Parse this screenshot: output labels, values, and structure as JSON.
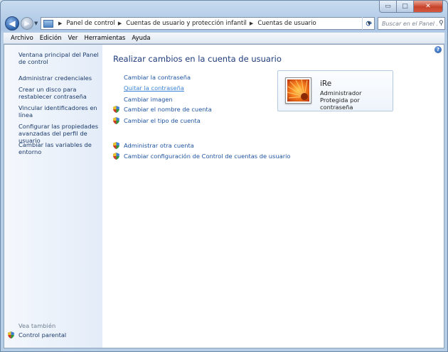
{
  "window_buttons": {
    "minimize": "▭",
    "maximize": "□",
    "close": "✕"
  },
  "address": {
    "breadcrumbs": [
      "Panel de control",
      "Cuentas de usuario y protección infantil",
      "Cuentas de usuario"
    ],
    "search_placeholder": "Buscar en el Panel ..."
  },
  "menu": [
    "Archivo",
    "Edición",
    "Ver",
    "Herramientas",
    "Ayuda"
  ],
  "sidebar": {
    "items": [
      "Ventana principal del Panel de control",
      "Administrar credenciales",
      "Crear un disco para restablecer contraseña",
      "Vincular identificadores en línea",
      "Configurar las propiedades avanzadas del perfil de usuario",
      "Cambiar las variables de entorno"
    ],
    "see_also": "Vea también",
    "parental": "Control parental"
  },
  "main": {
    "title": "Realizar cambios en la cuenta de usuario",
    "links": [
      "Cambiar la contraseña",
      "Quitar la contraseña",
      "Cambiar imagen"
    ],
    "shield_links": [
      "Cambiar el nombre de cuenta",
      "Cambiar el tipo de cuenta"
    ],
    "other_links": [
      "Administrar otra cuenta",
      "Cambiar configuración de Control de cuentas de usuario"
    ]
  },
  "user": {
    "name": "iRe",
    "role": "Administrador",
    "status": "Protegida por contraseña"
  },
  "colors": {
    "link": "#1e54a0",
    "title": "#1e3c7b",
    "sidebar_link": "#1b3a6b"
  }
}
